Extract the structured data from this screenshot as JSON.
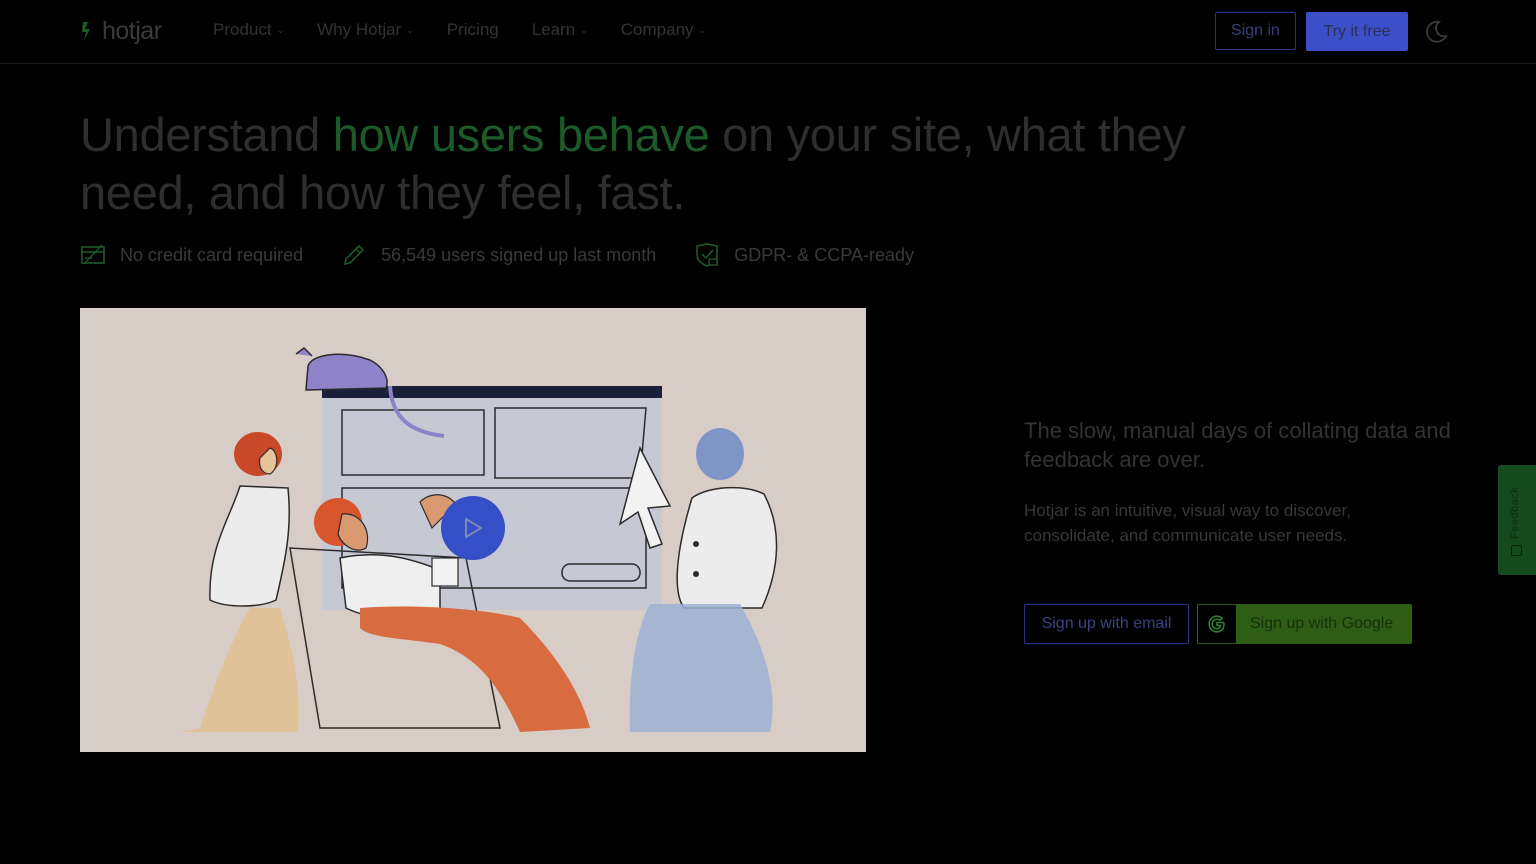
{
  "brand": {
    "name": "hotjar"
  },
  "nav": {
    "items": [
      {
        "label": "Product",
        "has_dropdown": true
      },
      {
        "label": "Why Hotjar",
        "has_dropdown": true
      },
      {
        "label": "Pricing",
        "has_dropdown": false
      },
      {
        "label": "Learn",
        "has_dropdown": true
      },
      {
        "label": "Company",
        "has_dropdown": true
      }
    ],
    "sign_in": "Sign in",
    "try_free": "Try it free",
    "theme_icon": "moon-icon"
  },
  "hero": {
    "headline_before": "Understand ",
    "headline_accent": "how users behave",
    "headline_after": " on your site, what they need, and how they feel, fast.",
    "benefits": [
      {
        "icon": "credit-card-icon",
        "text": "No credit card required"
      },
      {
        "icon": "pencil-icon",
        "text": "56,549 users signed up last month"
      },
      {
        "icon": "shield-lock-icon",
        "text": "GDPR- & CCPA-ready"
      }
    ]
  },
  "video": {
    "play_icon": "play-icon"
  },
  "side": {
    "tagline": "The slow, manual days of collating data and feedback are over.",
    "description": "Hotjar is an intuitive, visual way to discover, consolidate, and communicate user needs.",
    "signup_email": "Sign up with email",
    "signup_google": "Sign up with Google"
  },
  "feedback_tab": {
    "label": "Feedback"
  },
  "colors": {
    "background": "#000000",
    "accent_green": "#1d5a2a",
    "primary_blue": "#3c4fc9",
    "google_green": "#2e5d15",
    "video_bg": "#d8ccc6"
  }
}
